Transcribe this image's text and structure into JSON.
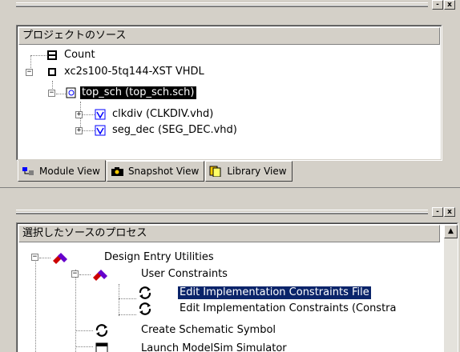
{
  "top_panel": {
    "header": "プロジェクトのソース",
    "tree": {
      "count": "Count",
      "device": "xc2s100-5tq144-XST VHDL",
      "top": "top_sch (top_sch.sch)",
      "child1": "clkdiv (CLKDIV.vhd)",
      "child2": "seg_dec (SEG_DEC.vhd)"
    },
    "tabs": [
      "Module View",
      "Snapshot View",
      "Library View"
    ]
  },
  "bottom_panel": {
    "header": "選択したソースのプロセス",
    "tree": {
      "design_entry": "Design Entry Utilities",
      "user_constraints": "User Constraints",
      "edit_impl": "Edit Implementation Constraints File",
      "edit_impl2": "Edit Implementation Constraints (Constra",
      "create_symbol": "Create Schematic Symbol",
      "launch_modelsim": "Launch ModelSim Simulator"
    }
  },
  "toolbar": {
    "min": "-",
    "close": "x"
  },
  "scroll": {
    "up": "▲"
  }
}
